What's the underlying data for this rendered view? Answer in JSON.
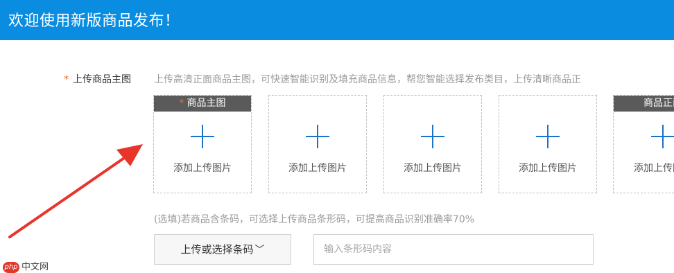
{
  "header": {
    "title": "欢迎使用新版商品发布！"
  },
  "main_image": {
    "required_mark": "*",
    "label": "上传商品主图",
    "hint": "上传高清正面商品主图，可快速智能识别及填充商品信息，帮您智能选择发布类目，上传清晰商品正",
    "slots": [
      {
        "tag": "商品主图",
        "tag_required": "*",
        "label": "添加上传图片"
      },
      {
        "tag": "",
        "label": "添加上传图片"
      },
      {
        "tag": "",
        "label": "添加上传图片"
      },
      {
        "tag": "",
        "label": "添加上传图片"
      },
      {
        "tag": "商品正面",
        "label": "添加上传图片"
      }
    ]
  },
  "barcode": {
    "hint": "(选填)若商品含条码，可选择上传商品条形码，可提高商品识别准确率70%",
    "button_label": "上传或选择条码",
    "button_icon": "chevron-down-icon",
    "input_placeholder": "输入条形码内容",
    "input_value": ""
  },
  "watermark": {
    "logo": "php",
    "text": "中文网"
  },
  "colors": {
    "header_bg": "#0a8ce0",
    "accent_blue": "#1a73c9",
    "required_star": "#f06a1d",
    "annotation_arrow": "#e8342a",
    "slot_tag_bg": "#5a5a5a"
  }
}
